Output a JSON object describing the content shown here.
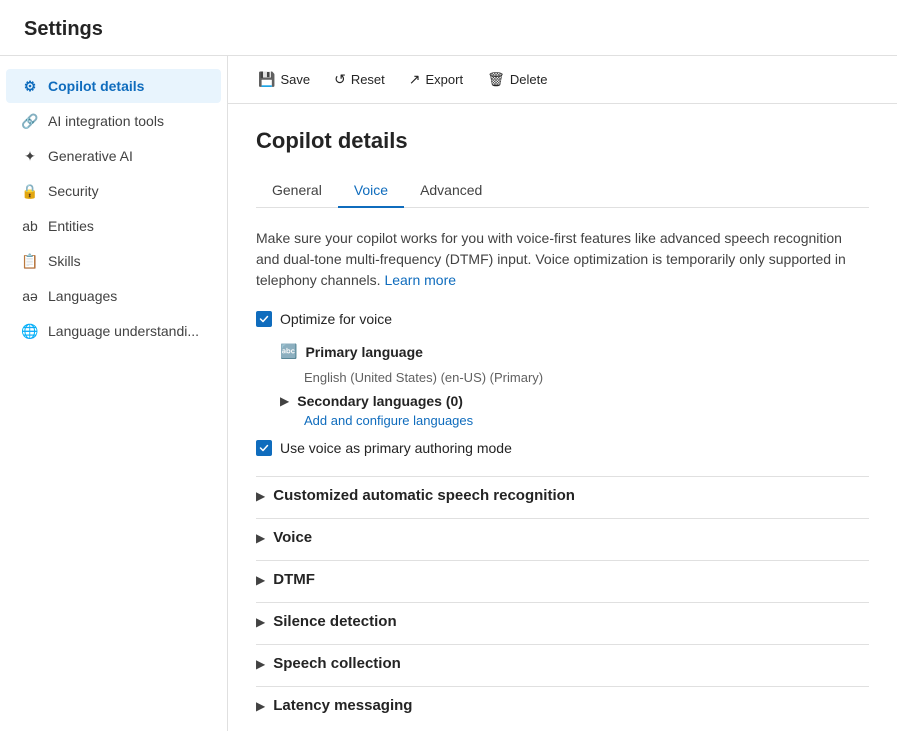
{
  "header": {
    "title": "Settings"
  },
  "sidebar": {
    "items": [
      {
        "id": "copilot-details",
        "label": "Copilot details",
        "icon": "⚙",
        "active": true
      },
      {
        "id": "ai-integration-tools",
        "label": "AI integration tools",
        "icon": "🔗",
        "active": false
      },
      {
        "id": "generative-ai",
        "label": "Generative AI",
        "icon": "✦",
        "active": false
      },
      {
        "id": "security",
        "label": "Security",
        "icon": "🔒",
        "active": false
      },
      {
        "id": "entities",
        "label": "Entities",
        "icon": "ab",
        "active": false
      },
      {
        "id": "skills",
        "label": "Skills",
        "icon": "📋",
        "active": false
      },
      {
        "id": "languages",
        "label": "Languages",
        "icon": "aə",
        "active": false
      },
      {
        "id": "language-understanding",
        "label": "Language understandi...",
        "icon": "🌐",
        "active": false
      }
    ]
  },
  "toolbar": {
    "buttons": [
      {
        "id": "save",
        "label": "Save",
        "icon": "💾"
      },
      {
        "id": "reset",
        "label": "Reset",
        "icon": "↺"
      },
      {
        "id": "export",
        "label": "Export",
        "icon": "↗"
      },
      {
        "id": "delete",
        "label": "Delete",
        "icon": "🗑"
      }
    ]
  },
  "page": {
    "title": "Copilot details",
    "tabs": [
      {
        "id": "general",
        "label": "General",
        "active": false
      },
      {
        "id": "voice",
        "label": "Voice",
        "active": true
      },
      {
        "id": "advanced",
        "label": "Advanced",
        "active": false
      }
    ],
    "description": "Make sure your copilot works for you with voice-first features like advanced speech recognition and dual-tone multi-frequency (DTMF) input. Voice optimization is temporarily only supported in telephony channels.",
    "learn_more": "Learn more",
    "optimize_voice_label": "Optimize for voice",
    "primary_language_label": "Primary language",
    "primary_language_value": "English (United States) (en-US) (Primary)",
    "secondary_languages_label": "Secondary languages (0)",
    "add_configure_languages": "Add and configure languages",
    "use_voice_label": "Use voice as primary authoring mode",
    "sections": [
      {
        "id": "custom-asr",
        "label": "Customized automatic speech recognition"
      },
      {
        "id": "voice",
        "label": "Voice"
      },
      {
        "id": "dtmf",
        "label": "DTMF"
      },
      {
        "id": "silence-detection",
        "label": "Silence detection"
      },
      {
        "id": "speech-collection",
        "label": "Speech collection"
      },
      {
        "id": "latency-messaging",
        "label": "Latency messaging"
      }
    ]
  }
}
